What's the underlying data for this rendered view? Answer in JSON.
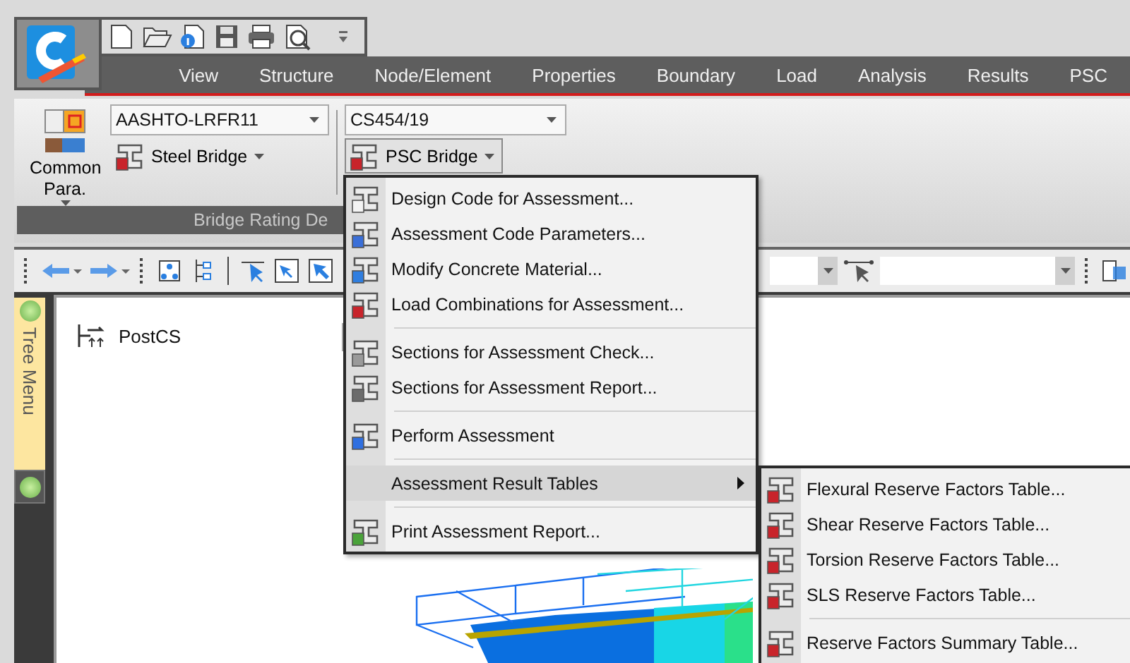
{
  "menu_tabs": [
    {
      "label": "View",
      "selected": false
    },
    {
      "label": "Structure",
      "selected": false
    },
    {
      "label": "Node/Element",
      "selected": false
    },
    {
      "label": "Properties",
      "selected": false
    },
    {
      "label": "Boundary",
      "selected": false
    },
    {
      "label": "Load",
      "selected": false
    },
    {
      "label": "Analysis",
      "selected": false
    },
    {
      "label": "Results",
      "selected": false
    },
    {
      "label": "PSC",
      "selected": false
    }
  ],
  "ribbon": {
    "common_button": {
      "label": "Common Para."
    },
    "code_combo": {
      "value": "AASHTO-LRFR11"
    },
    "steel_button": {
      "label": "Steel Bridge"
    },
    "stage_combo": {
      "value": "CS454/19"
    },
    "psc_button": {
      "label": "PSC Bridge",
      "pressed": true
    },
    "group_label": "Bridge Rating De"
  },
  "tree_menu_tab": {
    "label": "Tree Menu"
  },
  "tree_panel": {
    "root": "PostCS"
  },
  "psc_menu": {
    "groups": [
      [
        {
          "label": "Design Code for Assessment...",
          "selected": false,
          "submenu": false
        },
        {
          "label": "Assessment Code Parameters...",
          "selected": false,
          "submenu": false
        },
        {
          "label": "Modify Concrete Material...",
          "selected": false,
          "submenu": false
        },
        {
          "label": "Load Combinations for Assessment...",
          "selected": false,
          "submenu": false
        }
      ],
      [
        {
          "label": "Sections for Assessment Check...",
          "selected": false,
          "submenu": false
        },
        {
          "label": "Sections for Assessment Report...",
          "selected": false,
          "submenu": false
        }
      ],
      [
        {
          "label": "Perform Assessment",
          "selected": false,
          "submenu": false
        }
      ],
      [
        {
          "label": "Assessment Result Tables",
          "selected": true,
          "submenu": true
        }
      ],
      [
        {
          "label": "Print Assessment Report...",
          "selected": false,
          "submenu": false
        }
      ]
    ]
  },
  "result_tables_submenu": {
    "groups": [
      [
        {
          "label": "Flexural Reserve Factors Table...",
          "selected": false
        },
        {
          "label": "Shear Reserve Factors Table...",
          "selected": false
        },
        {
          "label": "Torsion Reserve Factors Table...",
          "selected": false
        },
        {
          "label": "SLS Reserve Factors Table...",
          "selected": false
        }
      ],
      [
        {
          "label": "Reserve Factors Summary Table...",
          "selected": false
        }
      ]
    ]
  }
}
